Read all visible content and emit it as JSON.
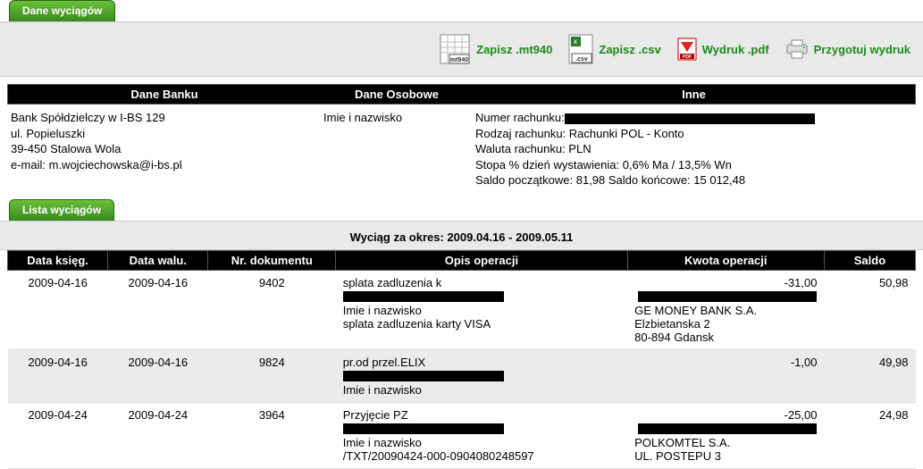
{
  "tabs": {
    "dane": "Dane wyciągów",
    "lista": "Lista wyciągów"
  },
  "toolbar": {
    "mt940": "Zapisz .mt940",
    "csv": "Zapisz .csv",
    "pdf": "Wydruk .pdf",
    "print": "Przygotuj wydruk"
  },
  "headers": {
    "bank": "Dane Banku",
    "osobowe": "Dane Osobowe",
    "inne": "Inne"
  },
  "bank": {
    "line1": "Bank Spółdzielczy w I-BS 129",
    "line2": "ul. Popieluszki",
    "line3": "39-450 Stalowa Wola",
    "line4": "e-mail: m.wojciechowska@i-bs.pl"
  },
  "osobowe": {
    "line1": "Imie i nazwisko"
  },
  "inne": {
    "numer_label": "Numer rachunku:",
    "rodzaj": "Rodzaj rachunku: Rachunki POL - Konto",
    "waluta": "Waluta rachunku: PLN",
    "stopa": "Stopa % dzień wystawienia: 0,6% Ma / 13,5% Wn",
    "salda": "Saldo początkowe: 81,98  Saldo końcowe: 15 012,48"
  },
  "period": {
    "label": "Wyciąg za okres:",
    "range": "2009.04.16 - 2009.05.11"
  },
  "cols": {
    "data_ksieg": "Data księg.",
    "data_walu": "Data walu.",
    "nr_dok": "Nr. dokumentu",
    "opis": "Opis operacji",
    "kwota": "Kwota operacji",
    "saldo": "Saldo"
  },
  "rows": [
    {
      "dk": "2009-04-16",
      "dw": "2009-04-16",
      "doc": "9402",
      "desc1": "splata zadluzenia k",
      "desc2": "Imie i nazwisko",
      "desc3": "splata zadluzenia karty VISA",
      "p1": "GE MONEY BANK S.A.",
      "p2": "Elzbietanska 2",
      "p3": "80-894 Gdansk",
      "amt": "-31,00",
      "bal": "50,98"
    },
    {
      "dk": "2009-04-16",
      "dw": "2009-04-16",
      "doc": "9824",
      "desc1": "pr.od przel.ELIX",
      "desc2": "Imie i nazwisko",
      "desc3": "",
      "p1": "",
      "p2": "",
      "p3": "",
      "amt": "-1,00",
      "bal": "49,98"
    },
    {
      "dk": "2009-04-24",
      "dw": "2009-04-24",
      "doc": "3964",
      "desc1": "Przyjęcie PZ",
      "desc2": "Imie i nazwisko",
      "desc3": "/TXT/20090424-000-0904080248597",
      "p1": "POLKOMTEL S.A.",
      "p2": "UL. POSTEPU 3",
      "p3": "",
      "amt": "-25,00",
      "bal": "24,98"
    }
  ]
}
